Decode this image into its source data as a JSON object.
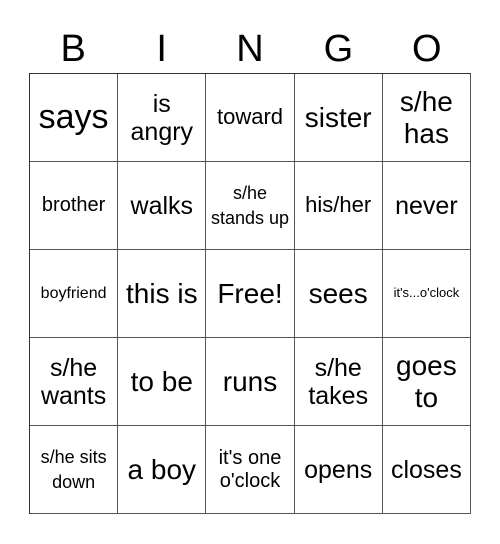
{
  "header": [
    "B",
    "I",
    "N",
    "G",
    "O"
  ],
  "cells": [
    [
      "says",
      "is angry",
      "toward",
      "sister",
      "s/he has"
    ],
    [
      "brother",
      "walks",
      "s/he stands up",
      "his/her",
      "never"
    ],
    [
      "boyfriend",
      "this is",
      "Free!",
      "sees",
      "it's...o'clock"
    ],
    [
      "s/he wants",
      "to be",
      "runs",
      "s/he takes",
      "goes to"
    ],
    [
      "s/he sits down",
      "a boy",
      "it's one o'clock",
      "opens",
      "closes"
    ]
  ]
}
